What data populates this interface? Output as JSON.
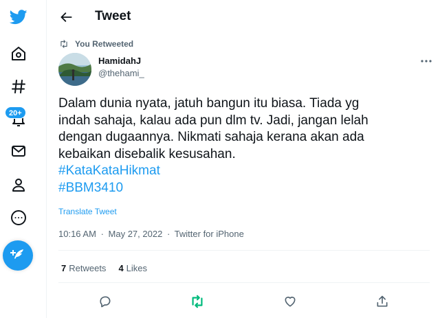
{
  "header": {
    "title": "Tweet"
  },
  "nav": {
    "icons": [
      "twitter-logo-icon",
      "home-icon",
      "explore-hash-icon",
      "bell-icon",
      "mail-icon",
      "profile-icon",
      "more-circle-icon",
      "compose-icon"
    ],
    "notification_badge": "20+"
  },
  "retweet_context": {
    "label": "You Retweeted"
  },
  "author": {
    "name": "HamidahJ",
    "handle": "@thehami_"
  },
  "tweet": {
    "lines": [
      "Dalam dunia nyata, jatuh bangun itu biasa. Tiada yg",
      "indah sahaja, kalau ada pun dlm tv. Jadi, jangan lelah",
      "dengan dugaannya. Nikmati sahaja kerana akan ada",
      "kebaikan disebalik kesusahan."
    ],
    "hashtags": [
      "#KataKataHikmat",
      "#BBM3410"
    ],
    "translate_label": "Translate Tweet",
    "time": "10:16 AM",
    "separator": "·",
    "date": "May 27, 2022",
    "source": "Twitter for iPhone"
  },
  "stats": {
    "retweets_count": "7",
    "retweets_label": "Retweets",
    "likes_count": "4",
    "likes_label": "Likes"
  },
  "colors": {
    "accent": "#1d9bf0",
    "retweet_green": "#00ba7c",
    "text": "#0f1419",
    "secondary": "#536471"
  }
}
